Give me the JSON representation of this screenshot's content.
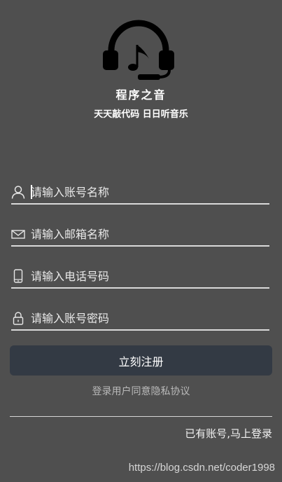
{
  "header": {
    "logo_icon": "headphones-music-note-icon",
    "app_name": "程序之音",
    "slogan": "天天敲代码 日日听音乐"
  },
  "form": {
    "account": {
      "icon": "user-icon",
      "placeholder": "请输入账号名称",
      "value": ""
    },
    "email": {
      "icon": "envelope-icon",
      "placeholder": "请输入邮箱名称",
      "value": ""
    },
    "phone": {
      "icon": "phone-icon",
      "placeholder": "请输入电话号码",
      "value": ""
    },
    "password": {
      "icon": "lock-icon",
      "placeholder": "请输入账号密码",
      "value": ""
    }
  },
  "actions": {
    "register_label": "立刻注册",
    "privacy_text": "登录用户同意隐私协议",
    "login_link": "已有账号,马上登录"
  },
  "watermark": "https://blog.csdn.net/coder1998",
  "colors": {
    "background": "#4f4f4f",
    "button": "#333a44",
    "text": "#ffffff",
    "muted_text": "#b9b9b9"
  }
}
